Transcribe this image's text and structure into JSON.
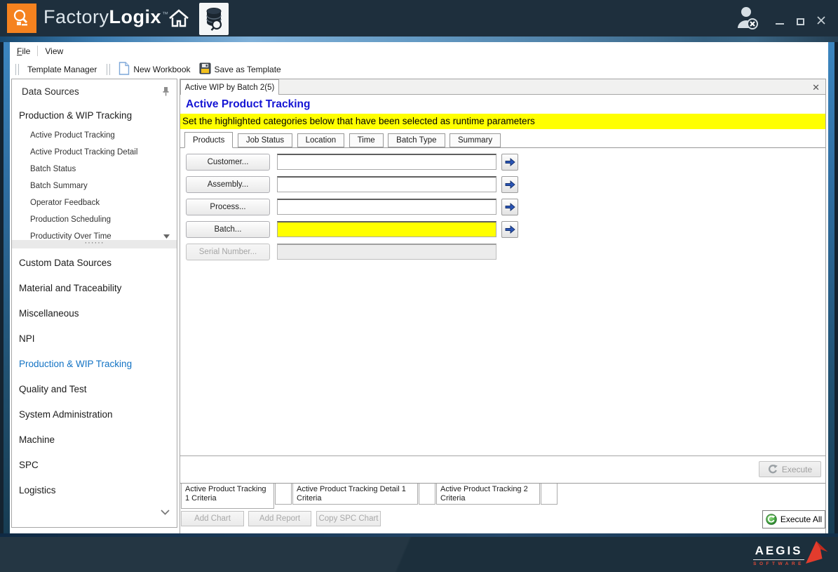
{
  "titlebar": {
    "brand_light": "Factory",
    "brand_bold": "Logix",
    "brand_tm": "™"
  },
  "menu": {
    "file": "File",
    "view": "View"
  },
  "toolbar": {
    "template_manager": "Template Manager",
    "new_workbook": "New Workbook",
    "save_as_template": "Save as Template"
  },
  "sidebar": {
    "header": "Data Sources",
    "group": "Production & WIP Tracking",
    "group_items": [
      "Active Product Tracking",
      "Active Product Tracking Detail",
      "Batch Status",
      "Batch Summary",
      "Operator Feedback",
      "Production Scheduling",
      "Productivity Over Time"
    ],
    "splitter_dots": "······",
    "sections": [
      "Custom Data Sources",
      "Material and Traceability",
      "Miscellaneous",
      "NPI",
      "Production & WIP Tracking",
      "Quality and Test",
      "System Administration",
      "Machine",
      "SPC",
      "Logistics"
    ],
    "selected_section": "Production & WIP Tracking"
  },
  "document": {
    "tab": "Active WIP by Batch 2(5)",
    "close": "✕",
    "title": "Active Product Tracking",
    "banner": "Set the highlighted categories below that have been selected as runtime parameters",
    "tabs": [
      "Products",
      "Job Status",
      "Location",
      "Time",
      "Batch Type",
      "Summary"
    ],
    "selected_tab": "Products",
    "form": {
      "rows": [
        {
          "label": "Customer...",
          "value": "",
          "highlighted": false,
          "disabled": false
        },
        {
          "label": "Assembly...",
          "value": "",
          "highlighted": false,
          "disabled": false
        },
        {
          "label": "Process...",
          "value": "",
          "highlighted": false,
          "disabled": false
        },
        {
          "label": "Batch...",
          "value": "",
          "highlighted": true,
          "disabled": false
        },
        {
          "label": "Serial Number...",
          "value": "",
          "highlighted": false,
          "disabled": true
        }
      ]
    },
    "execute": "Execute",
    "criteria_tabs": [
      "Active Product Tracking 1 Criteria",
      "Active Product Tracking Detail 1 Criteria",
      "Active Product Tracking 2 Criteria"
    ],
    "buttons": {
      "add_chart": "Add Chart",
      "add_report": "Add Report",
      "copy_spc_chart": "Copy SPC Chart",
      "execute_all": "Execute All"
    }
  },
  "footer": {
    "brand": "AEGIS",
    "sub": "SOFTWARE"
  },
  "colors": {
    "titlebar_bg": "#1e2f3d",
    "logo_orange": "#f5821f",
    "accent_title_blue": "#1414d4",
    "highlight_yellow": "#ffff00",
    "selected_sidebar_blue": "#1373c4"
  }
}
